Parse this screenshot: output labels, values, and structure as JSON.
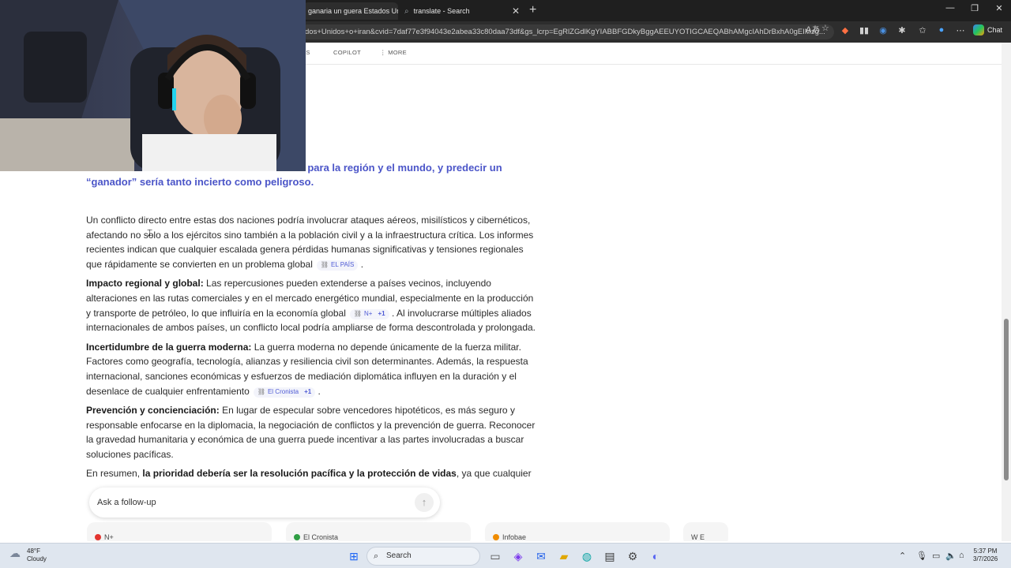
{
  "browser": {
    "tabs": [
      {
        "title": "ganaria un guera Estados Ur",
        "active": true
      },
      {
        "title": "translate - Search",
        "active": false
      }
    ],
    "address": "dos+Unidos+o+iran&cvid=7daf77e3f94043e2abea33c80daa73df&gs_lcrp=EgRlZGdlKgYIABBFGDkyBggAEEUYOTIGCAEQABhAMgcIAhDrBxhA0gEIMzg...",
    "chat_label": "Chat"
  },
  "bing_nav": {
    "items": [
      "WS",
      "COPILOT",
      "MORE"
    ]
  },
  "answer": {
    "lead": "s e Irán tendría consecuencias devastadoras para la región y el mundo, y predecir un “ganador” sería tanto incierto como peligroso.",
    "p1": "Un conflicto directo entre estas dos naciones podría involucrar ataques aéreos, misilísticos y cibernéticos, afectando no solo a los ejércitos sino también a la población civil y a la infraestructura crítica. Los informes recientes indican que cualquier escalada genera pérdidas humanas significativas y tensiones regionales que rápidamente se convierten en un problema global",
    "p1_cite": "EL PAÍS",
    "p2_head": "Impacto regional y global:",
    "p2_a": " Las repercusiones pueden extenderse a países vecinos, incluyendo alteraciones en las rutas comerciales y en el mercado energético mundial, especialmente en la producción y transporte de petróleo, lo que influiría en la economía global",
    "p2_cite": "N+",
    "p2_cite_more": "+1",
    "p2_b": ". Al involucrarse múltiples aliados internacionales de ambos países, un conflicto local podría ampliarse de forma descontrolada y prolongada.",
    "p3_head": "Incertidumbre de la guerra moderna:",
    "p3_a": " La guerra moderna no depende únicamente de la fuerza militar. Factores como geografía, tecnología, alianzas y resiliencia civil son determinantes. Además, la respuesta internacional, sanciones económicas y esfuerzos de mediación diplomática influyen en la duración y el desenlace de cualquier enfrentamiento",
    "p3_cite": "El Cronista",
    "p3_cite_more": "+1",
    "p4_head": "Prevención y concienciación:",
    "p4_a": " En lugar de especular sobre vencedores hipotéticos, es más seguro y responsable enfocarse en la diplomacia, la negociación de conflictos y la prevención de guerra. Reconocer la gravedad humanitaria y económica de una guerra puede incentivar a las partes involucradas a buscar soluciones pacíficas.",
    "p5_a": "En resumen, ",
    "p5_bold": "la prioridad debería ser la resolución pacífica y la protección de vidas",
    "p5_b": ", ya que cualquier"
  },
  "followup": {
    "placeholder": "Ask a follow-up"
  },
  "sources": [
    {
      "name": "N+",
      "color": "#e3342f"
    },
    {
      "name": "El Cronista",
      "color": "#2f9e44"
    },
    {
      "name": "Infobae",
      "color": "#f08c00"
    },
    {
      "name": "W E",
      "color": "#888888"
    }
  ],
  "taskbar": {
    "temperature": "48°F",
    "condition": "Cloudy",
    "search_label": "Search",
    "time": "5:37 PM",
    "date": "3/7/2026"
  }
}
